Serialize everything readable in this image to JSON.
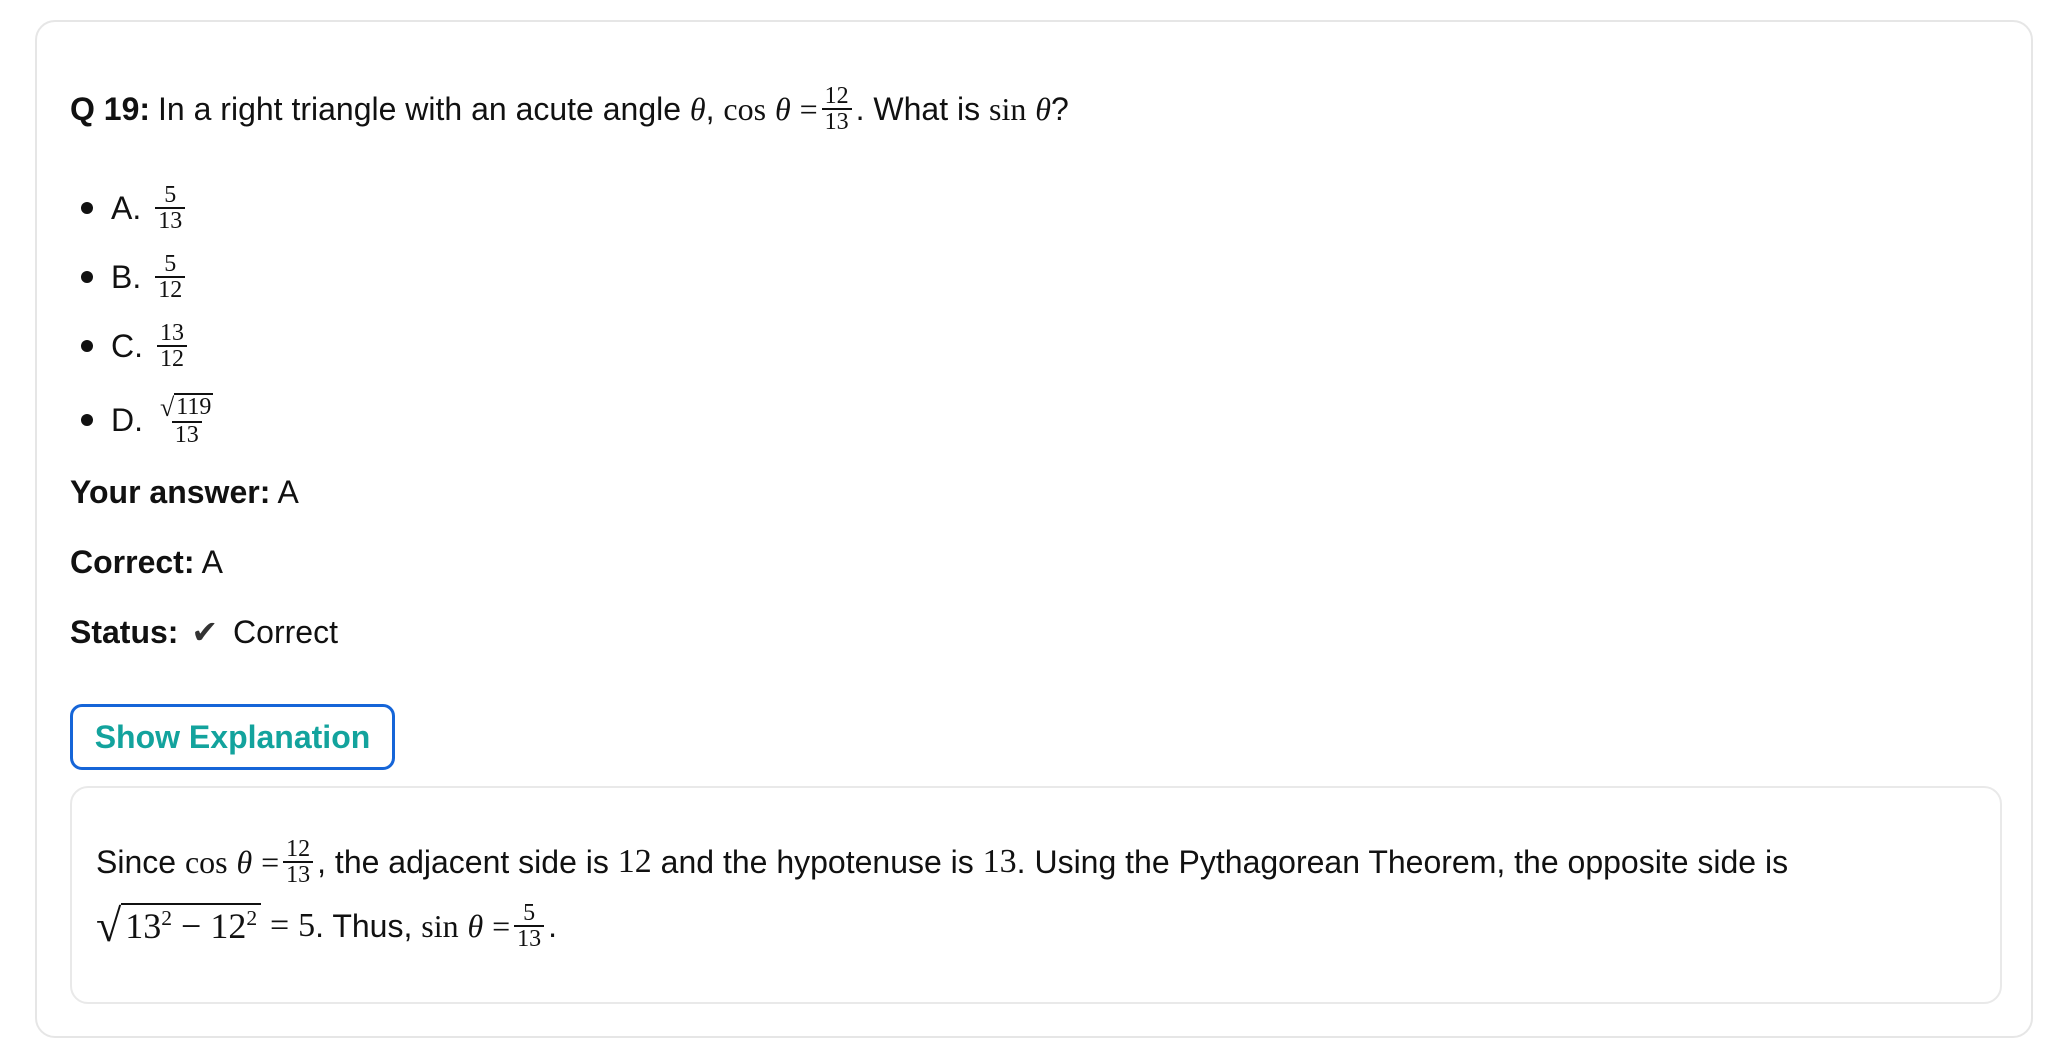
{
  "question": {
    "number_label": "Q 19:",
    "text_before": "In a right triangle with an acute angle",
    "theta": "θ",
    "comma": ",",
    "cos": "cos",
    "equals": "=",
    "frac_num": "12",
    "frac_den": "13",
    "text_after": ". What is",
    "sin": "sin",
    "qmark": "?"
  },
  "options": [
    {
      "letter": "A.",
      "num": "5",
      "den": "13"
    },
    {
      "letter": "B.",
      "num": "5",
      "den": "12"
    },
    {
      "letter": "C.",
      "num": "13",
      "den": "12"
    },
    {
      "letter": "D.",
      "num": "119",
      "den": "13",
      "num_has_sqrt": true
    }
  ],
  "answer": {
    "your_label": "Your answer:",
    "your_value": "A",
    "correct_label": "Correct:",
    "correct_value": "A",
    "status_label": "Status:",
    "status_icon": "check-icon",
    "status_value": "Correct"
  },
  "explain_button": {
    "label": "Show Explanation"
  },
  "explanation": {
    "since": "Since",
    "cos": "cos",
    "theta": "θ",
    "equals": "=",
    "frac_num": "12",
    "frac_den": "13",
    "mid1": ", the adjacent side is",
    "adj": "12",
    "mid2": "and the hypotenuse is",
    "hyp": "13",
    "mid3": ". Using the Pythagorean Theorem, the opposite side is",
    "radicand_a": "13",
    "minus": "−",
    "radicand_b": "12",
    "exp": "2",
    "equals2": "=",
    "result": "5",
    "thus": ". Thus,",
    "sin": "sin",
    "equals3": "=",
    "frac2_num": "5",
    "frac2_den": "13",
    "period": "."
  },
  "colors": {
    "button_border": "#1565d8",
    "button_text": "#13a39d",
    "card_border": "#e6e6e6"
  }
}
